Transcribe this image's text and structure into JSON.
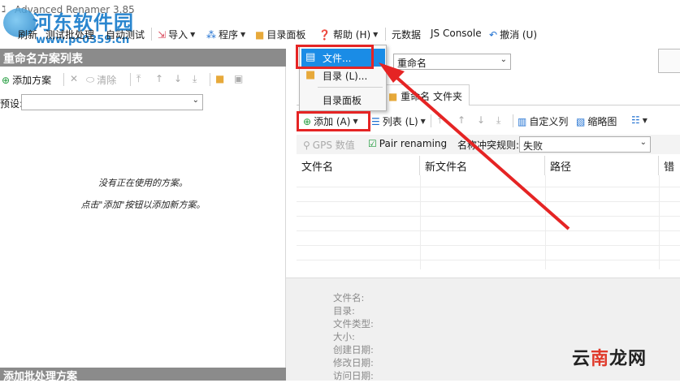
{
  "window": {
    "title": "Advanced Renamer 3.85"
  },
  "watermark": {
    "site": "河东软件园",
    "url": "www.pc0359.cn",
    "corner": "云南龙网",
    "corner_red": "南"
  },
  "toolbar": {
    "refresh": "刷新",
    "test_batch": "测试批处理",
    "auto_test": "自动测试",
    "import": "导入",
    "program": "程序",
    "directory_panel": "目录面板",
    "help": "帮助 (H)",
    "metadata": "元数据",
    "js_console": "JS Console",
    "undo": "撤消 (U)"
  },
  "left_panel": {
    "header": "重命名方案列表",
    "add_method": "添加方案",
    "clear": "清除",
    "preset_label": "预设:",
    "preset_value": "",
    "empty_line1": "没有正在使用的方案。",
    "empty_line2": "点击\"添加\"按钮以添加新方案。",
    "bottom_header": "添加批处理方案"
  },
  "mode_select": {
    "value": "重命名"
  },
  "context_menu": {
    "items": [
      {
        "label": "文件...",
        "selected": true
      },
      {
        "label": "目录 (L)..."
      },
      {
        "label": "目录面板"
      }
    ]
  },
  "tabs": [
    {
      "label": "重命名 文件夹"
    }
  ],
  "file_tools": {
    "add": "添加 (A)",
    "list": "列表 (L)",
    "custom_columns": "自定义列",
    "thumbnails": "缩略图"
  },
  "options": {
    "gps": "GPS 数值",
    "pair_renaming": "Pair renaming",
    "conflict_label": "名称冲突规则:",
    "conflict_value": "失败"
  },
  "grid": {
    "columns": [
      "文件名",
      "新文件名",
      "路径",
      "错误"
    ]
  },
  "info": {
    "labels": [
      "文件名:",
      "目录:",
      "文件类型:",
      "大小:",
      "创建日期:",
      "修改日期:",
      "访问日期:"
    ]
  },
  "colors": {
    "accent": "#1a8ce6",
    "highlight": "#e52424",
    "header_gray": "#8b8b8b"
  }
}
